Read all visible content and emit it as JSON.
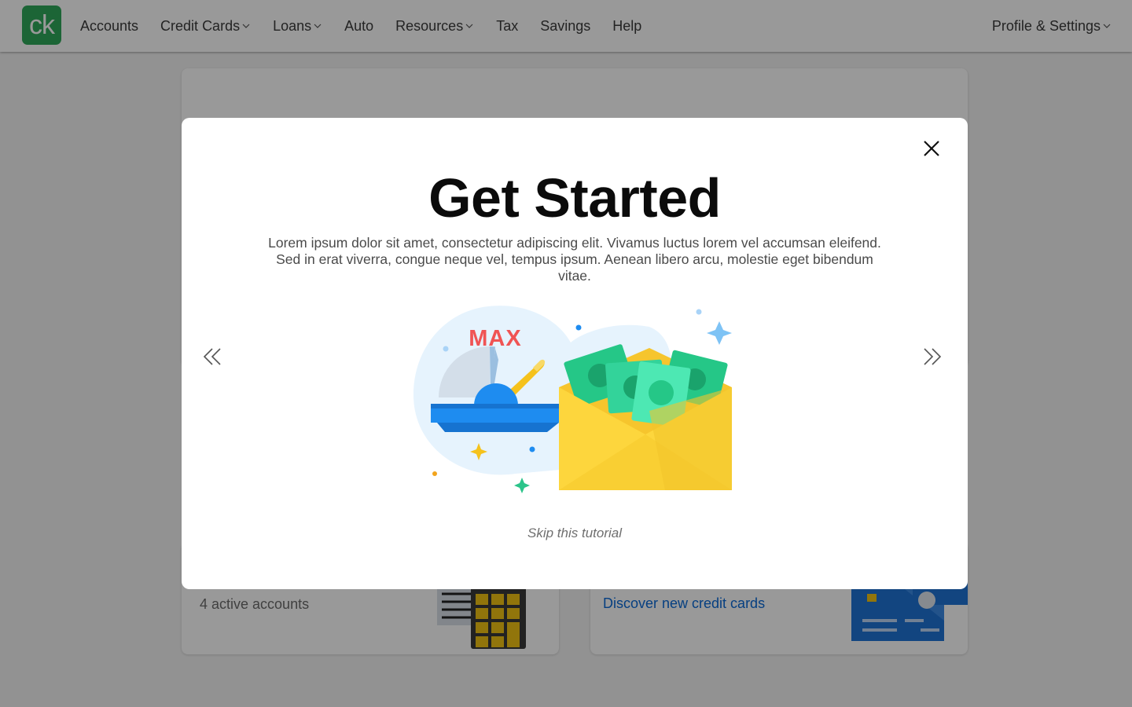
{
  "brand": {
    "logo_text": "ck",
    "logo_color": "#2fa85a"
  },
  "nav": {
    "items": [
      {
        "label": "Accounts",
        "has_dropdown": false
      },
      {
        "label": "Credit Cards",
        "has_dropdown": true
      },
      {
        "label": "Loans",
        "has_dropdown": true
      },
      {
        "label": "Auto",
        "has_dropdown": false
      },
      {
        "label": "Resources",
        "has_dropdown": true
      },
      {
        "label": "Tax",
        "has_dropdown": false
      },
      {
        "label": "Savings",
        "has_dropdown": false
      },
      {
        "label": "Help",
        "has_dropdown": false
      }
    ],
    "profile_label": "Profile & Settings"
  },
  "background": {
    "accounts_summary": "4 active accounts",
    "discover_link": "Discover new credit cards"
  },
  "modal": {
    "title": "Get Started",
    "description": "Lorem ipsum dolor sit amet, consectetur adipiscing elit. Vivamus luctus lorem vel accumsan eleifend. Sed in erat viverra, congue neque vel, tempus ipsum. Aenean libero arcu, molestie eget bibendum vitae.",
    "illustration_label": "MAX",
    "skip_label": "Skip this tutorial",
    "icons": {
      "close": "close-icon",
      "prev": "double-chevron-left-icon",
      "next": "double-chevron-right-icon"
    }
  },
  "colors": {
    "link": "#0a6ad8",
    "overlay": "rgba(0,0,0,0.4)",
    "max_text": "#f05454",
    "gauge_blue": "#1e8cf0",
    "money_green": "#2fd9a0",
    "envelope_yellow": "#fdd63d"
  }
}
